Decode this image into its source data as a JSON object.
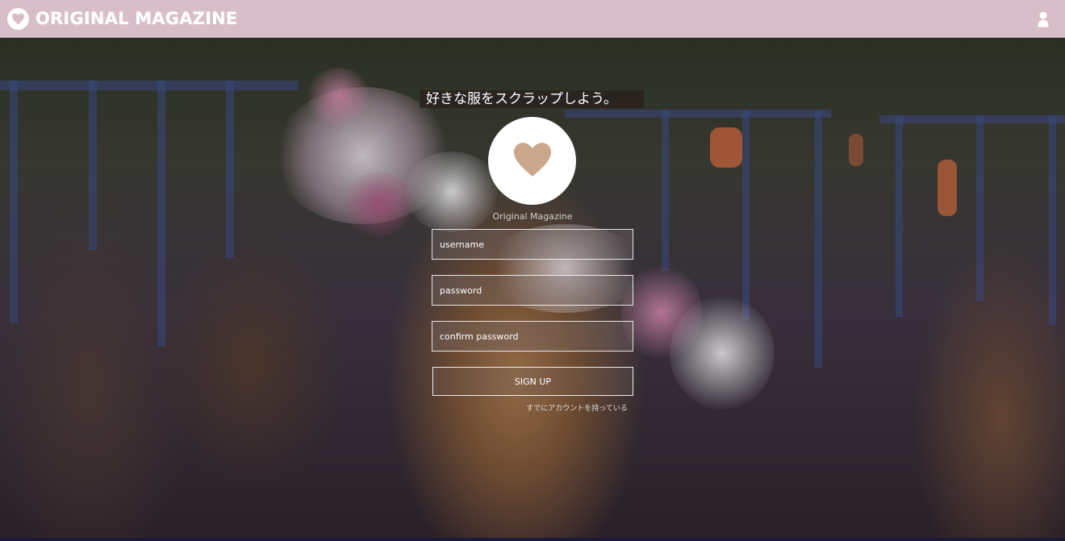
{
  "app": {
    "brand_name": "ORIGINAL MAGAZINE",
    "brand_icon": "heart-icon",
    "user_icon": "user-icon",
    "nav_color": "#d8bec8"
  },
  "hero": {
    "tagline": "好きな服をスクラップしよう。",
    "logo_icon": "heart-icon",
    "logo_caption": "Original Magazine"
  },
  "form": {
    "username_placeholder": "username",
    "password_placeholder": "password",
    "confirm_placeholder": "confirm password",
    "submit_label": "SIGN UP",
    "login_link": "すでにアカウントを持っている"
  }
}
